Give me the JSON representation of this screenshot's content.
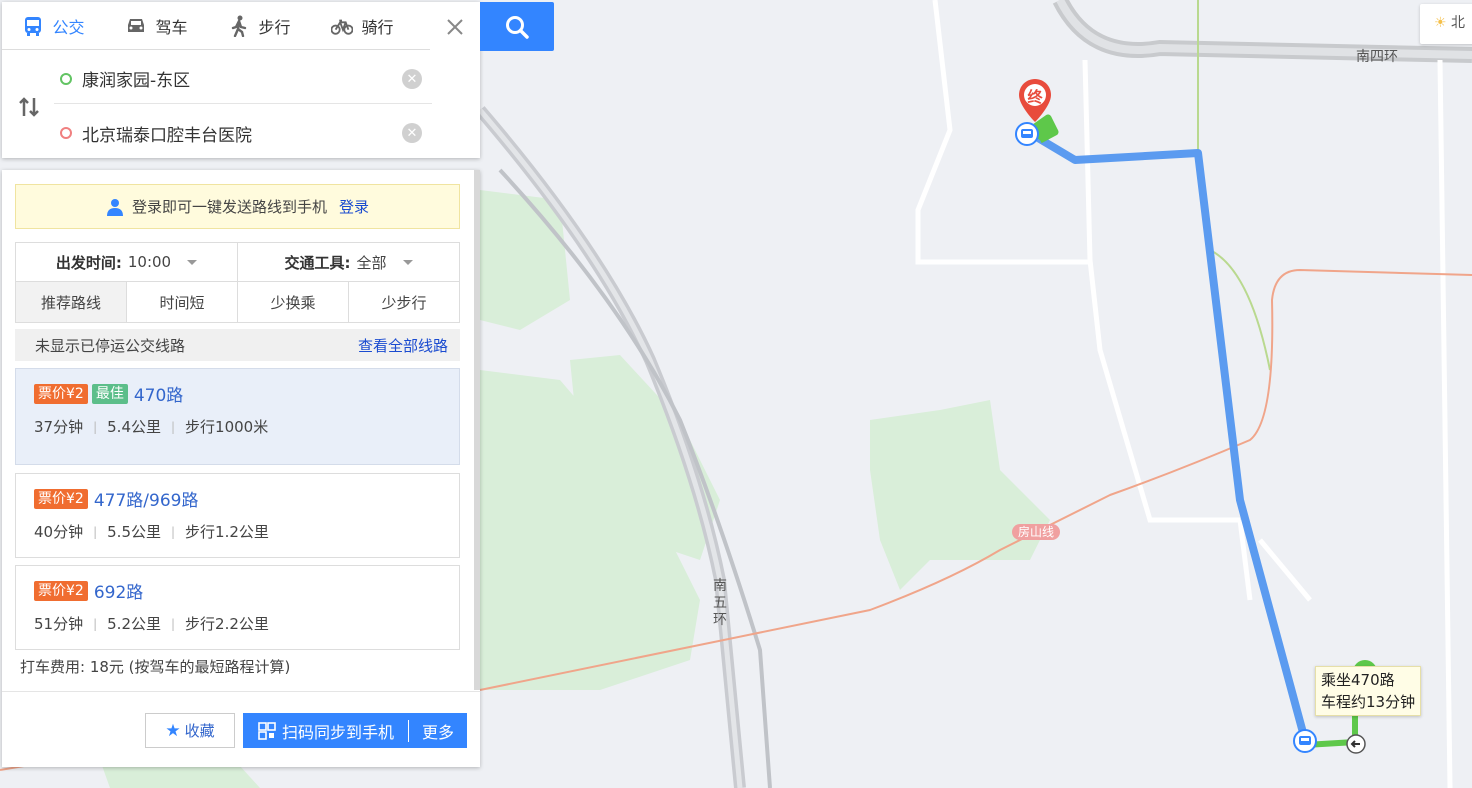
{
  "modes": [
    {
      "label": "公交",
      "icon": "bus-icon",
      "active": true
    },
    {
      "label": "驾车",
      "icon": "car-icon",
      "active": false
    },
    {
      "label": "步行",
      "icon": "walk-icon",
      "active": false
    },
    {
      "label": "骑行",
      "icon": "bike-icon",
      "active": false
    }
  ],
  "origin": "康润家园-东区",
  "destination": "北京瑞泰口腔丰台医院",
  "login_tip": {
    "text": "登录即可一键发送路线到手机",
    "link": "登录"
  },
  "options": {
    "depart_label": "出发时间:",
    "depart_value": "10:00",
    "vehicle_label": "交通工具:",
    "vehicle_value": "全部",
    "tabs": [
      "推荐路线",
      "时间短",
      "少换乘",
      "少步行"
    ],
    "active_tab": 0
  },
  "notice": {
    "text": "未显示已停运公交线路",
    "link": "查看全部线路"
  },
  "routes": [
    {
      "price": "票价¥2",
      "best": "最佳",
      "name": "470路",
      "time": "37分钟",
      "distance": "5.4公里",
      "walk": "步行1000米"
    },
    {
      "price": "票价¥2",
      "best": "",
      "name": "477路/969路",
      "time": "40分钟",
      "distance": "5.5公里",
      "walk": "步行1.2公里"
    },
    {
      "price": "票价¥2",
      "best": "",
      "name": "692路",
      "time": "51分钟",
      "distance": "5.2公里",
      "walk": "步行2.2公里"
    }
  ],
  "taxi": "打车费用: 18元 (按驾车的最短路程计算)",
  "footer": {
    "fav": "收藏",
    "sync": "扫码同步到手机",
    "more": "更多"
  },
  "map": {
    "ring4_label": "南四环",
    "ring5_label": [
      "南",
      "五",
      "环"
    ],
    "rail_label": "房山线",
    "end_pin": "终",
    "tip_line1": "乘坐470路",
    "tip_line2": "车程约13分钟",
    "weather_text": "北"
  },
  "colors": {
    "accent": "#3385ff",
    "route_line": "#5b9bf0",
    "walk_line": "#5ec84a",
    "price_tag": "#f06d30",
    "best_tag": "#5cbe8a"
  }
}
